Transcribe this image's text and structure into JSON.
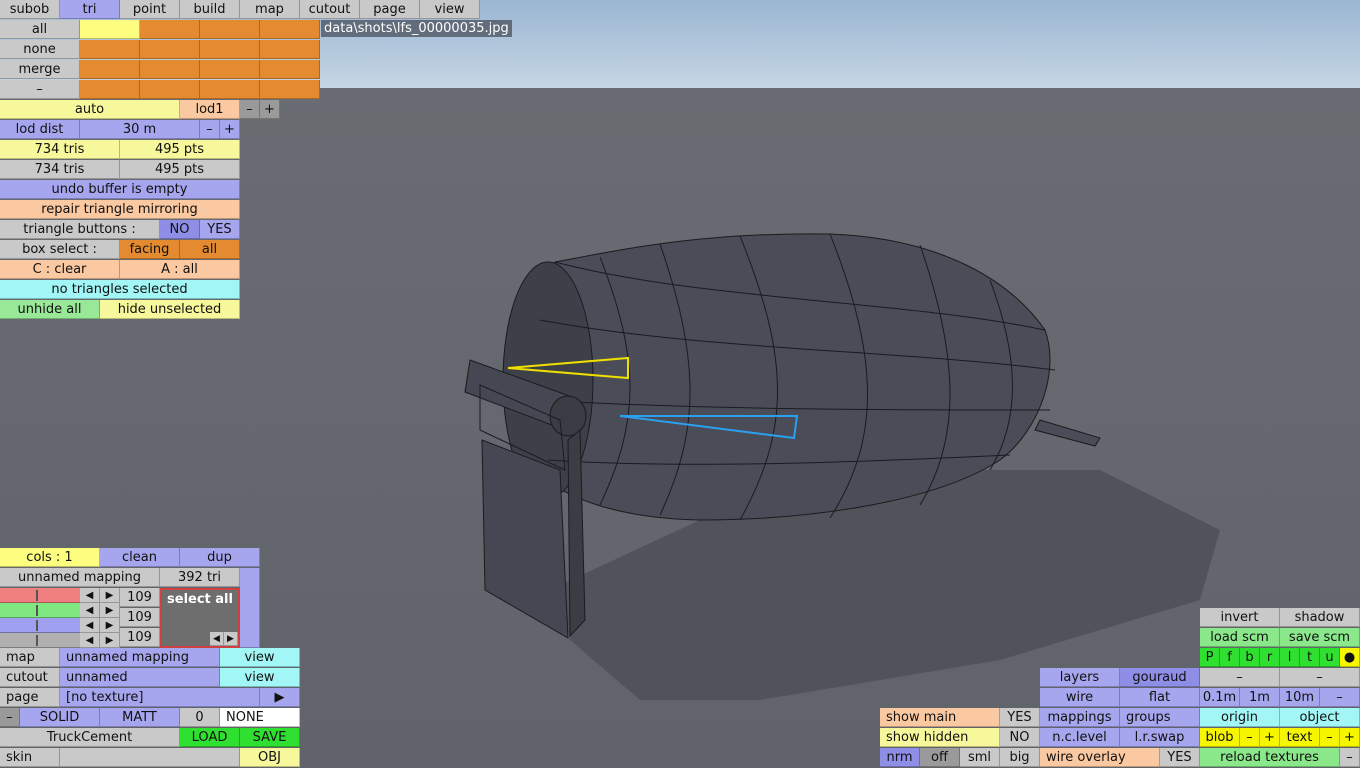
{
  "tabs": [
    "subob",
    "tri",
    "point",
    "build",
    "map",
    "cutout",
    "page",
    "view"
  ],
  "active_tab": "tri",
  "selection": {
    "all": "all",
    "none": "none",
    "merge": "merge",
    "minus": "–"
  },
  "filename": "data\\shots\\lfs_00000035.jpg",
  "lod": {
    "auto": "auto",
    "level": "lod1",
    "minus": "–",
    "plus": "+"
  },
  "lod_dist": {
    "label": "lod dist",
    "value": "30 m",
    "minus": "–",
    "plus": "+"
  },
  "counts": [
    {
      "tris": "734 tris",
      "pts": "495 pts"
    },
    {
      "tris": "734 tris",
      "pts": "495 pts"
    }
  ],
  "undo": "undo buffer is empty",
  "repair": "repair triangle mirroring",
  "triangle_buttons": {
    "label": "triangle buttons :",
    "no": "NO",
    "yes": "YES"
  },
  "box_select": {
    "label": "box select :",
    "facing": "facing",
    "all": "all"
  },
  "clear_all": {
    "clear": "C : clear",
    "all": "A : all"
  },
  "no_selected": "no triangles selected",
  "hide": {
    "unhide": "unhide all",
    "hide": "hide unselected"
  },
  "mapping": {
    "cols": "cols : 1",
    "clean": "clean",
    "dup": "dup",
    "name": "unnamed mapping",
    "tri": "392 tri",
    "channels": [
      "109",
      "109",
      "109"
    ],
    "select_all": "select all",
    "left_arrow": "◀",
    "right_arrow": "▶"
  },
  "map_row": {
    "label": "map",
    "value": "unnamed mapping",
    "view": "view"
  },
  "cutout_row": {
    "label": "cutout",
    "value": "unnamed",
    "view": "view"
  },
  "page_row": {
    "label": "page",
    "value": "[no texture]",
    "arrow": "▶"
  },
  "material": {
    "minus": "–",
    "solid": "SOLID",
    "matt": "MATT",
    "zero": "0",
    "none": "NONE"
  },
  "file_row": {
    "name": "TruckCement",
    "load": "LOAD",
    "save": "SAVE"
  },
  "skin_row": {
    "label": "skin",
    "value": "",
    "obj": "OBJ"
  },
  "right_panel": {
    "invert": "invert",
    "shadow": "shadow",
    "load_scm": "load scm",
    "save_scm": "save scm",
    "letters": [
      "P",
      "f",
      "b",
      "r",
      "l",
      "t",
      "u",
      "●"
    ],
    "minus1": "–",
    "minus2": "–",
    "layers": "layers",
    "gouraud": "gouraud",
    "wire": "wire",
    "flat": "flat",
    "d01": "0.1m",
    "d1": "1m",
    "d10": "10m",
    "dminus": "–",
    "show_main": "show main",
    "show_main_val": "YES",
    "mappings": "mappings",
    "groups": "groups",
    "origin": "origin",
    "object": "object",
    "show_hidden": "show hidden",
    "show_hidden_val": "NO",
    "nc_level": "n.c.level",
    "lr_swap": "l.r.swap",
    "blob": "blob",
    "blob_minus": "–",
    "blob_plus": "+",
    "text": "text",
    "text_minus": "–",
    "text_plus": "+",
    "nrm": "nrm",
    "off": "off",
    "sml": "sml",
    "big": "big",
    "wire_overlay": "wire overlay",
    "wire_overlay_val": "YES",
    "reload": "reload textures",
    "reload_minus": "–"
  },
  "colors": {
    "accent_blue": "#a6a6ee",
    "accent_orange": "#e48b31",
    "accent_yellow": "#f7f79c",
    "selection_yellow": "#f0e000",
    "selection_blue": "#2aa0f0"
  }
}
